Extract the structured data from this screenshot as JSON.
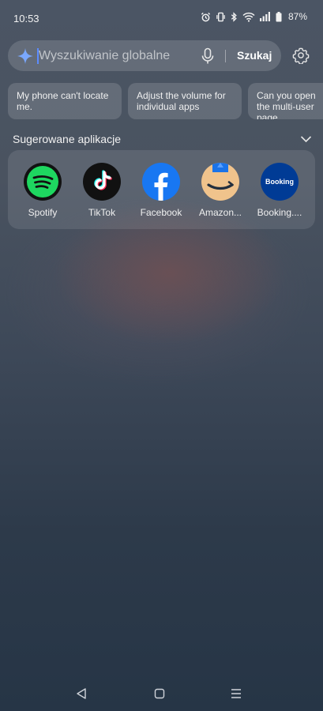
{
  "status": {
    "time": "10:53",
    "battery": "87%",
    "icons": [
      "alarm-icon",
      "vibrate-icon",
      "bluetooth-icon",
      "wifi-icon",
      "signal-icon",
      "battery-icon"
    ]
  },
  "search": {
    "placeholder": "Wyszukiwanie globalne",
    "button_label": "Szukaj"
  },
  "suggestions": [
    {
      "text": "My phone can't locate me."
    },
    {
      "text": "Adjust the volume for individual apps"
    },
    {
      "text": "Can you open the multi-user page"
    }
  ],
  "apps_section": {
    "title": "Sugerowane aplikacje",
    "apps": [
      {
        "label": "Spotify",
        "icon": "spotify-icon"
      },
      {
        "label": "TikTok",
        "icon": "tiktok-icon"
      },
      {
        "label": "Facebook",
        "icon": "facebook-icon"
      },
      {
        "label": "Amazon...",
        "icon": "amazon-icon"
      },
      {
        "label": "Booking....",
        "icon": "booking-icon",
        "icon_text": "Booking"
      }
    ]
  },
  "nav": {
    "icons": [
      "back-icon",
      "home-icon",
      "recents-icon"
    ]
  },
  "colors": {
    "accent": "#5c8cff",
    "spotify": "#1ed760",
    "facebook": "#1877f2",
    "booking": "#003b95",
    "amazon_bg": "#f0c38c"
  }
}
